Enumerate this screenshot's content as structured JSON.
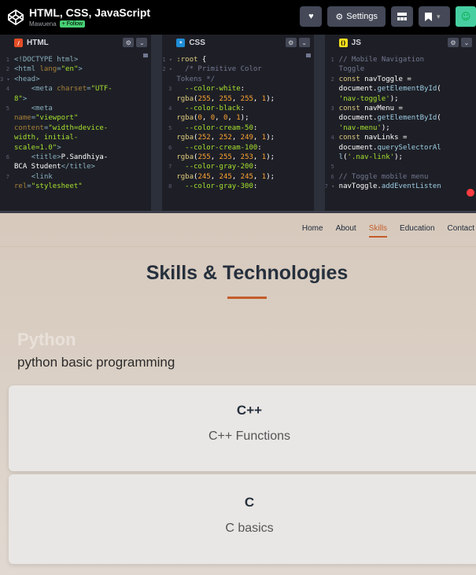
{
  "pen": {
    "title": "HTML, CSS, JavaScript",
    "author": "Mawuena",
    "follow_label": "+ Follow"
  },
  "toolbar": {
    "settings_label": "Settings",
    "icons": [
      "heart-icon",
      "gear-icon",
      "layout-icon",
      "bookmark-icon",
      "chevron-down-icon",
      "avatar"
    ]
  },
  "editors": {
    "html_label": "HTML",
    "css_label": "CSS",
    "js_label": "JS",
    "badges": {
      "html": "/",
      "css": "*",
      "js": "()"
    }
  },
  "preview": {
    "nav": [
      "Home",
      "About",
      "Skills",
      "Education",
      "Contact"
    ],
    "active_nav": "Skills",
    "section_title": "Skills & Technologies",
    "skills": [
      {
        "title": "Python",
        "desc": "python basic programming"
      },
      {
        "title": "C++",
        "desc": "C++ Functions"
      },
      {
        "title": "C",
        "desc": "C basics"
      }
    ]
  },
  "colors": {
    "accent": "#c45c2a",
    "follow": "#47cf73",
    "html_badge": "#e44d26",
    "css_badge": "#1f8dd6",
    "js_badge": "#f7df1e"
  }
}
